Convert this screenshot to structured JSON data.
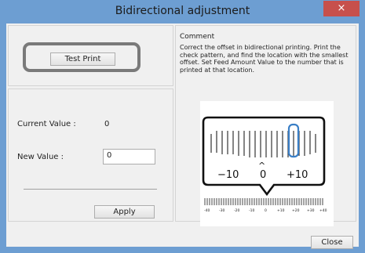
{
  "window": {
    "title": "Bidirectional adjustment",
    "close_glyph": "×"
  },
  "left": {
    "test_print_label": "Test Print",
    "current_value_label": "Current Value :",
    "current_value": "0",
    "new_value_label": "New Value :",
    "new_value": "0",
    "apply_label": "Apply"
  },
  "comment": {
    "heading": "Comment",
    "text": "Correct the offset in bidirectional printing. Print the check pattern, and find the location with the smallest offset. Set Feed Amount Value to the number that is printed at that location."
  },
  "illustration": {
    "callout_labels": [
      "−10",
      "0",
      "+10"
    ],
    "caret": "^",
    "scale_labels": [
      "-40",
      "-30",
      "-20",
      "-10",
      "0",
      "+10",
      "+20",
      "+30",
      "+40"
    ]
  },
  "footer": {
    "close_label": "Close"
  }
}
